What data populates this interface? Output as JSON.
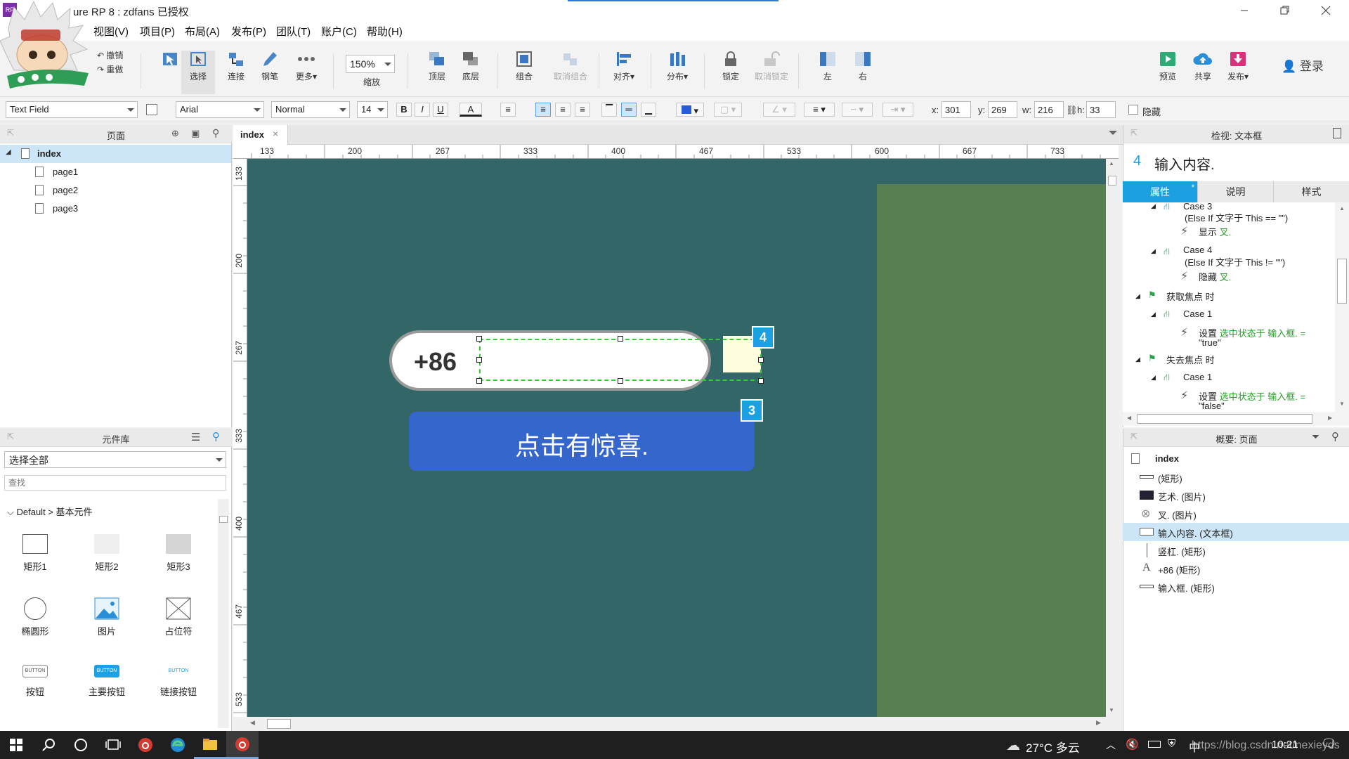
{
  "app": {
    "title": "ure RP 8 : zdfans 已授权",
    "title_prefix": "A",
    "accent": "#2d7bd5"
  },
  "menu": [
    "视图(V)",
    "项目(P)",
    "布局(A)",
    "发布(P)",
    "团队(T)",
    "账户(C)",
    "帮助(H)"
  ],
  "toolbar": {
    "undo": "撤销",
    "redo": "重做",
    "select": "选择",
    "connect": "连接",
    "pen": "钢笔",
    "more": "更多",
    "zoom_value": "150%",
    "zoom_label": "缩放",
    "top_layer": "顶层",
    "bottom_layer": "底层",
    "group": "组合",
    "ungroup": "取消组合",
    "align": "对齐",
    "distribute": "分布",
    "lock": "锁定",
    "unlock": "取消锁定",
    "left": "左",
    "right": "右",
    "preview": "预览",
    "share": "共享",
    "publish": "发布",
    "login": "登录"
  },
  "formatbar": {
    "widget_type": "Text Field",
    "font": "Arial",
    "style": "Normal",
    "size": "14",
    "bold": "B",
    "italic": "I",
    "underline": "U",
    "font_color_glyph": "A",
    "x_label": "x:",
    "x": "301",
    "y_label": "y:",
    "y": "269",
    "w_label": "w:",
    "w": "216",
    "h_label": "h:",
    "h": "33",
    "hidden_label": "隐藏",
    "fill_color": "#2a5bd7"
  },
  "pages_panel": {
    "title": "页面",
    "root": "index",
    "children": [
      "page1",
      "page2",
      "page3"
    ]
  },
  "library_panel": {
    "title": "元件库",
    "select": "选择全部",
    "search_placeholder": "查找",
    "group": "Default > 基本元件",
    "widgets": [
      "矩形1",
      "矩形2",
      "矩形3",
      "椭圆形",
      "图片",
      "占位符",
      "按钮",
      "主要按钮",
      "链接按钮"
    ],
    "button_text": "BUTTON"
  },
  "canvas": {
    "tab": "index",
    "ruler_top": [
      "133",
      "200",
      "267",
      "333",
      "400",
      "467",
      "533",
      "600",
      "667",
      "733"
    ],
    "ruler_left": [
      "133",
      "200",
      "267",
      "333",
      "400",
      "467",
      "533"
    ],
    "bg": "#336666",
    "green_panel": "#56804f",
    "prefix": "+86",
    "badge_input": "4",
    "badge_button": "3",
    "button_text": "点击有惊喜.",
    "button_color": "#3466cc"
  },
  "inspector": {
    "header": "检视: 文本框",
    "badge": "4",
    "name": "输入内容.",
    "tabs": [
      "属性",
      "说明",
      "样式"
    ],
    "rows": [
      {
        "text": "Case 3",
        "kind": "case"
      },
      {
        "text": "(Else If 文字于 This == \"\")",
        "kind": "cond"
      },
      {
        "text": "显示",
        "green": "叉.",
        "kind": "action"
      },
      {
        "text": "Case 4",
        "kind": "case"
      },
      {
        "text": "(Else If 文字于 This != \"\")",
        "kind": "cond"
      },
      {
        "text": "隐藏",
        "green": "叉.",
        "kind": "action"
      },
      {
        "text": "获取焦点 时",
        "kind": "event"
      },
      {
        "text": "Case 1",
        "kind": "case"
      },
      {
        "text": "设置",
        "green": "选中状态于 输入框. =",
        "kind": "action"
      },
      {
        "green": "\"true\"",
        "kind": "value"
      },
      {
        "text": "失去焦点 时",
        "kind": "event"
      },
      {
        "text": "Case 1",
        "kind": "case"
      },
      {
        "text": "设置",
        "green": "选中状态于 输入框. =",
        "kind": "action"
      },
      {
        "green": "\"false\"",
        "kind": "value"
      }
    ]
  },
  "outline": {
    "header": "概要: 页面",
    "root": "index",
    "items": [
      {
        "label": "(矩形)",
        "icon": "rect-line-icon"
      },
      {
        "label": "艺术. (图片)",
        "icon": "image-icon"
      },
      {
        "label": "叉. (图片)",
        "icon": "close-circle-icon"
      },
      {
        "label": "输入内容. (文本框)",
        "icon": "textfield-icon",
        "selected": true
      },
      {
        "label": "竖杠. (矩形)",
        "icon": "vertical-line-icon"
      },
      {
        "label": "+86 (矩形)",
        "icon": "text-a-icon"
      },
      {
        "label": "输入框. (矩形)",
        "icon": "rect-line-icon"
      }
    ]
  },
  "taskbar": {
    "weather": "27°C 多云",
    "ime": "中",
    "watermark": "https://blog.csdn.net/nexieyds",
    "time": "10:21"
  }
}
